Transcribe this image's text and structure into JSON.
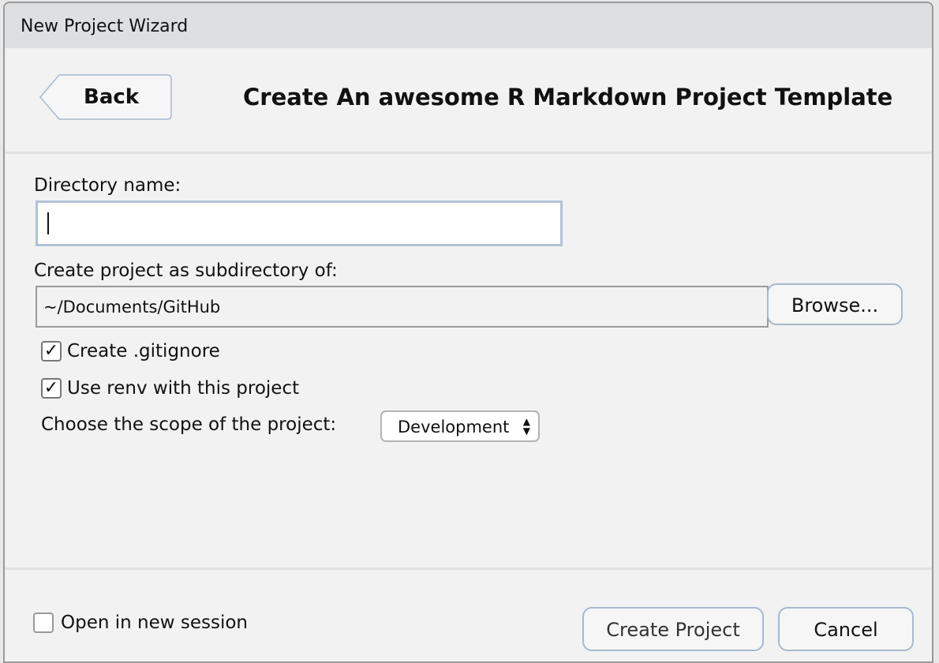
{
  "window": {
    "title": "New Project Wizard"
  },
  "header": {
    "back_label": "Back",
    "title": "Create An awesome R Markdown Project Template"
  },
  "form": {
    "directory_label": "Directory name:",
    "directory_value": "",
    "parent_label": "Create project as subdirectory of:",
    "parent_value": "~/Documents/GitHub",
    "browse_label": "Browse...",
    "gitignore": {
      "label": "Create .gitignore",
      "checked": true
    },
    "renv": {
      "label": "Use renv with this project",
      "checked": true
    },
    "scope_label": "Choose the scope of the project:",
    "scope_value": "Development"
  },
  "footer": {
    "new_session": {
      "label": "Open in new session",
      "checked": false
    },
    "create_label": "Create Project",
    "cancel_label": "Cancel"
  }
}
